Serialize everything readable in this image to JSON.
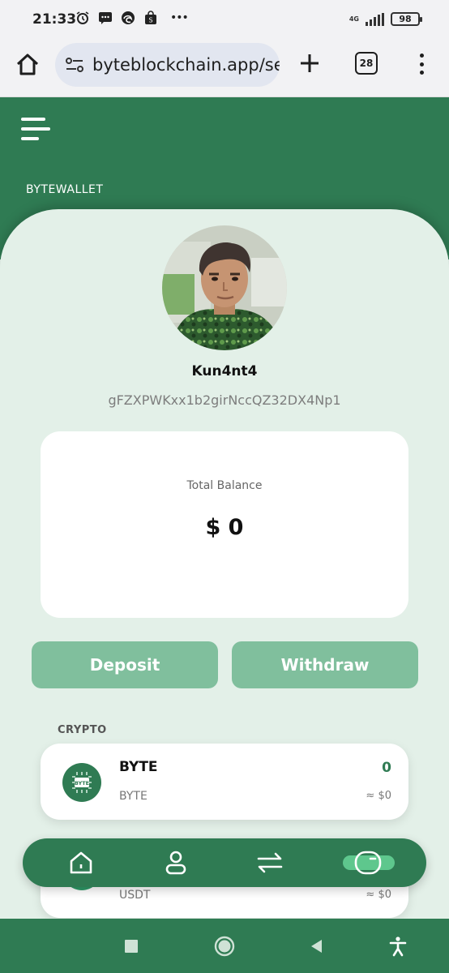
{
  "status_bar": {
    "time": "21:33",
    "network": "4G",
    "battery": "98",
    "overflow": "•••"
  },
  "browser": {
    "url": "byteblockchain.app/se",
    "tab_count": "28"
  },
  "app": {
    "brand": "BYTEWALLET",
    "username": "Kun4nt4",
    "wallet_address": "gFZXPWKxx1b2girNccQZ32DX4Np1",
    "balance_label": "Total Balance",
    "balance_value": "$ 0",
    "deposit_label": "Deposit",
    "withdraw_label": "Withdraw",
    "crypto_section_title": "CRYPTO",
    "assets": [
      {
        "name": "BYTE",
        "symbol": "BYTE",
        "amount": "0",
        "usd": "≈ $0",
        "icon": "byte-coin-icon",
        "icon_text": "BYTE"
      },
      {
        "name": "USDT",
        "symbol": "USDT",
        "amount": "",
        "usd": "≈ $0",
        "icon": "usdt-coin-icon"
      }
    ]
  },
  "bottom_nav": {
    "items": [
      "home-icon",
      "profile-icon",
      "transfer-icon",
      "wallet-icon"
    ],
    "active": "wallet-icon"
  },
  "colors": {
    "brand_green": "#2f7b53",
    "button_green": "#80bf9d",
    "panel_bg": "#e3f0e8",
    "active_pill": "#5ec78d"
  }
}
